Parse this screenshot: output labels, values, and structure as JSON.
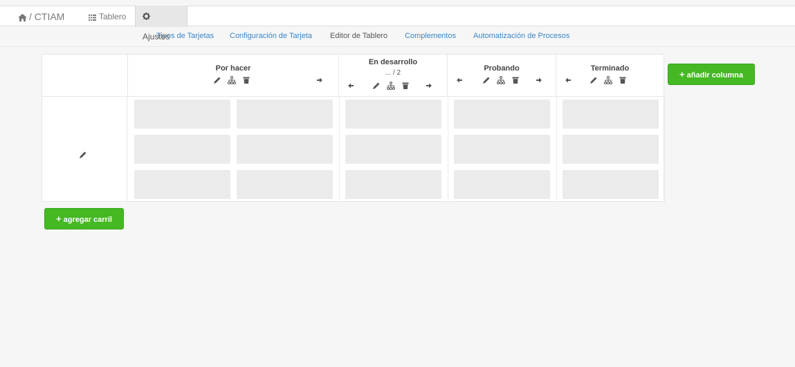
{
  "header": {
    "brand": "/ CTIAM",
    "tabs": [
      {
        "label": "Tablero",
        "icon": "board-icon"
      },
      {
        "label": "Ajustes",
        "icon": "gear-icon",
        "active": true
      }
    ]
  },
  "subnav": [
    {
      "label": "Tipos de Tarjetas"
    },
    {
      "label": "Configuración de Tarjeta"
    },
    {
      "label": "Editor de Tablero",
      "active": true
    },
    {
      "label": "Complementos"
    },
    {
      "label": "Automatización de Procesos"
    }
  ],
  "columns": [
    {
      "title": "Por hacer",
      "subtitle": ""
    },
    {
      "title": "En desarrollo",
      "subtitle": "... / 2"
    },
    {
      "title": "Probando",
      "subtitle": ""
    },
    {
      "title": "Terminado",
      "subtitle": ""
    }
  ],
  "actions": {
    "add_column": "añadir columna",
    "add_lane": "agregar carril"
  },
  "colors": {
    "accent_green": "#45b823",
    "link_blue": "#3a86c8"
  }
}
